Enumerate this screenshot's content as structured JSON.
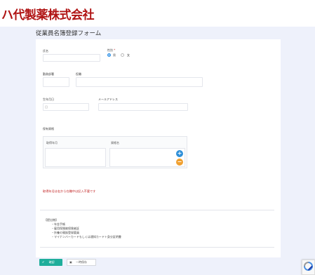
{
  "header": {
    "logo_text": "ハ代製薬株式会社"
  },
  "page": {
    "title": "従業員名簿登録フォーム"
  },
  "form": {
    "name_label": "氏名",
    "gender_label": "性別",
    "required_mark": "*",
    "gender_options": [
      {
        "label": "男",
        "selected": true
      },
      {
        "label": "女",
        "selected": false
      }
    ],
    "department_label": "勤務部署",
    "position_label": "役職",
    "birthdate_label": "生年月日",
    "birthdate_placeholder": "日",
    "email_label": "メールアドレス"
  },
  "qualifications": {
    "section_label": "保有資格",
    "columns": [
      "取得年月",
      "資格名"
    ],
    "add_button": "+",
    "remove_button": "−"
  },
  "warning_text": "取得年月は右から在職中は記入不要です",
  "documents": {
    "heading": "【提出物】",
    "items": [
      "年金手帳",
      "雇用保険被保険者証",
      "扶養の親族登録要員",
      "マイナンバーカードもしくは通知カード＋身分証明書"
    ]
  },
  "buttons": {
    "confirm": "確認",
    "draft": "一時保存"
  },
  "colors": {
    "brand": "#b01414",
    "accent": "#1fae9b",
    "add": "#2e8fd8",
    "remove": "#f0a030",
    "warning": "#c02020"
  }
}
